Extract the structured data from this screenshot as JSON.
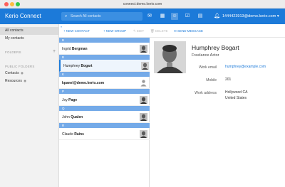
{
  "browser": {
    "url": "connect.demo.kerio.com"
  },
  "header": {
    "app_title": "Kerio Connect",
    "search_placeholder": "Search All contacts",
    "user": "1444423913@demo.kerio.com ▾",
    "icons": [
      "mail-icon",
      "calendar-icon",
      "contacts-icon",
      "tasks-icon",
      "notes-icon",
      "bell-icon"
    ],
    "accent": "#1c7ad9"
  },
  "sidebar": {
    "all_contacts": "All contacts",
    "my_contacts": "My contacts",
    "folders_heading": "FOLDERS",
    "public_heading": "PUBLIC FOLDERS",
    "public_contacts": "Contacts",
    "public_resources": "Resources"
  },
  "toolbar": {
    "new_contact": "NEW CONTACT",
    "new_group": "NEW GROUP",
    "edit": "EDIT",
    "delete": "DELETE",
    "send_message": "SEND MESSAGE"
  },
  "list": {
    "letters": [
      "B",
      "B",
      "K",
      "P",
      "Q",
      "R"
    ],
    "rows": [
      {
        "first": "Ingrid ",
        "last": "Bergman"
      },
      {
        "first": "Humphrey ",
        "last": "Bogart"
      },
      {
        "first": "",
        "last": "kpanel@demo.kerio.com"
      },
      {
        "first": "Joy ",
        "last": "Page"
      },
      {
        "first": "John ",
        "last": "Qualen"
      },
      {
        "first": "Claude ",
        "last": "Rains"
      }
    ]
  },
  "detail": {
    "name": "Humphrey Bogart",
    "title": "Freelance Actor",
    "work_email_label": "Work email",
    "work_email": "humphrey@example.com",
    "mobile_label": "Mobile",
    "mobile": "201",
    "work_address_label": "Work address",
    "address_line1": "Hollywood CA",
    "address_line2": "United States"
  }
}
